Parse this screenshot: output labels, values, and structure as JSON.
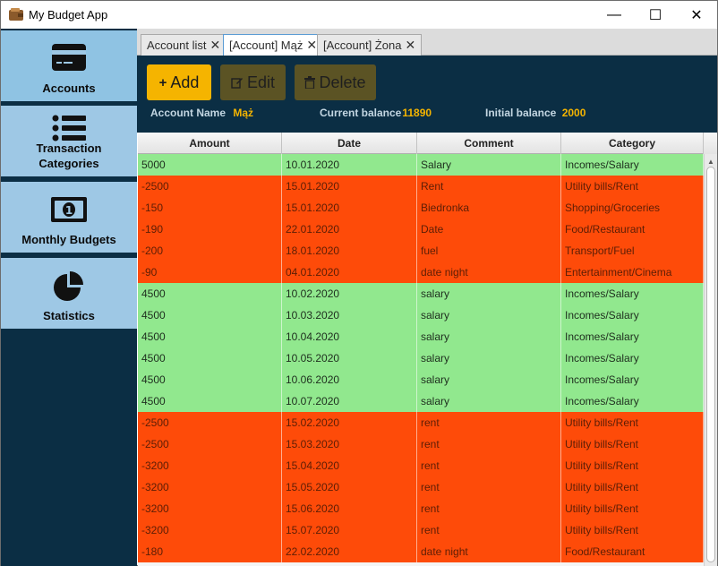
{
  "window": {
    "title": "My Budget App",
    "minimize_glyph": "—",
    "maximize_glyph": "☐",
    "close_glyph": "✕"
  },
  "sidebar": {
    "items": [
      {
        "label": "Accounts",
        "icon": "credit-card-icon"
      },
      {
        "label": "Transaction Categories",
        "icon": "list-icon"
      },
      {
        "label": "Monthly Budgets",
        "icon": "banknote-icon"
      },
      {
        "label": "Statistics",
        "icon": "pie-chart-icon"
      }
    ]
  },
  "tabs": [
    {
      "label": "Account list",
      "close": "✕"
    },
    {
      "label": "[Account] Mąż",
      "close": "✕"
    },
    {
      "label": "[Account] Żona",
      "close": "✕"
    }
  ],
  "toolbar": {
    "add_label": "Add",
    "edit_label": "Edit",
    "delete_label": "Delete"
  },
  "account_info": {
    "name_label": "Account Name",
    "name_value": "Mąż",
    "current_label": "Current balance",
    "current_value": "11890",
    "initial_label": "Initial balance",
    "initial_value": "2000"
  },
  "table": {
    "columns": [
      "Amount",
      "Date",
      "Comment",
      "Category"
    ],
    "rows": [
      [
        "5000",
        "10.01.2020",
        "Salary",
        "Incomes/Salary",
        "in"
      ],
      [
        "-2500",
        "15.01.2020",
        "Rent",
        "Utility bills/Rent",
        "out"
      ],
      [
        "-150",
        "15.01.2020",
        "Biedronka",
        "Shopping/Groceries",
        "out"
      ],
      [
        "-190",
        "22.01.2020",
        "Date",
        "Food/Restaurant",
        "out"
      ],
      [
        "-200",
        "18.01.2020",
        "fuel",
        "Transport/Fuel",
        "out"
      ],
      [
        "-90",
        "04.01.2020",
        "date night",
        "Entertainment/Cinema",
        "out"
      ],
      [
        "4500",
        "10.02.2020",
        "salary",
        "Incomes/Salary",
        "in"
      ],
      [
        "4500",
        "10.03.2020",
        "salary",
        "Incomes/Salary",
        "in"
      ],
      [
        "4500",
        "10.04.2020",
        "salary",
        "Incomes/Salary",
        "in"
      ],
      [
        "4500",
        "10.05.2020",
        "salary",
        "Incomes/Salary",
        "in"
      ],
      [
        "4500",
        "10.06.2020",
        "salary",
        "Incomes/Salary",
        "in"
      ],
      [
        "4500",
        "10.07.2020",
        "salary",
        "Incomes/Salary",
        "in"
      ],
      [
        "-2500",
        "15.02.2020",
        "rent",
        "Utility bills/Rent",
        "out"
      ],
      [
        "-2500",
        "15.03.2020",
        "rent",
        "Utility bills/Rent",
        "out"
      ],
      [
        "-3200",
        "15.04.2020",
        "rent",
        "Utility bills/Rent",
        "out"
      ],
      [
        "-3200",
        "15.05.2020",
        "rent",
        "Utility bills/Rent",
        "out"
      ],
      [
        "-3200",
        "15.06.2020",
        "rent",
        "Utility bills/Rent",
        "out"
      ],
      [
        "-3200",
        "15.07.2020",
        "rent",
        "Utility bills/Rent",
        "out"
      ],
      [
        "-180",
        "22.02.2020",
        "date night",
        "Food/Restaurant",
        "out"
      ]
    ]
  },
  "colors": {
    "sidebar_bg": "#0b2e44",
    "nav_bg": "#9ec8e5",
    "accent": "#f5b400",
    "income_row": "#91e88e",
    "expense_row": "#fe4b09"
  }
}
